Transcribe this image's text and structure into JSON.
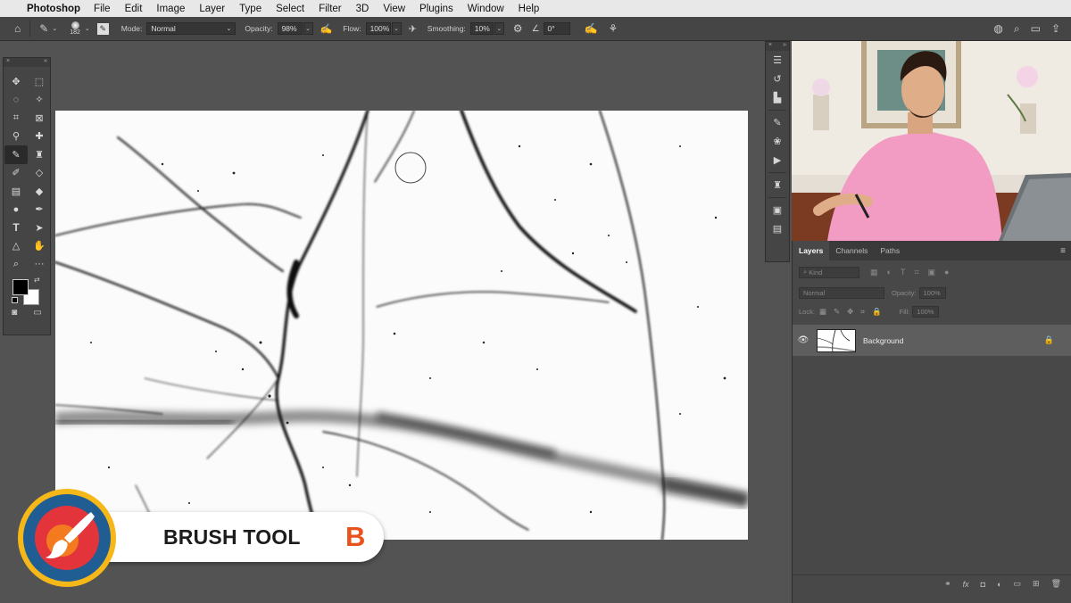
{
  "menubar": {
    "app": "Photoshop",
    "items": [
      "File",
      "Edit",
      "Image",
      "Layer",
      "Type",
      "Select",
      "Filter",
      "3D",
      "View",
      "Plugins",
      "Window",
      "Help"
    ]
  },
  "options": {
    "brush_size": "182",
    "mode_label": "Mode:",
    "mode_value": "Normal",
    "opacity_label": "Opacity:",
    "opacity_value": "98%",
    "flow_label": "Flow:",
    "flow_value": "100%",
    "smoothing_label": "Smoothing:",
    "smoothing_value": "10%",
    "angle_value": "0°"
  },
  "lower_third": {
    "title": "BRUSH TOOL",
    "shortcut": "B"
  },
  "layers_panel": {
    "tabs": [
      "Layers",
      "Channels",
      "Paths"
    ],
    "kind_placeholder": "Kind",
    "blend_mode": "Normal",
    "opacity_label": "Opacity:",
    "opacity_value": "100%",
    "lock_label": "Lock:",
    "fill_label": "Fill:",
    "fill_value": "100%",
    "layer_name": "Background"
  },
  "colors": {
    "accent_orange": "#e8521c",
    "badge_yellow": "#f5b818",
    "badge_blue": "#1f5d93",
    "badge_red": "#e3343c"
  }
}
